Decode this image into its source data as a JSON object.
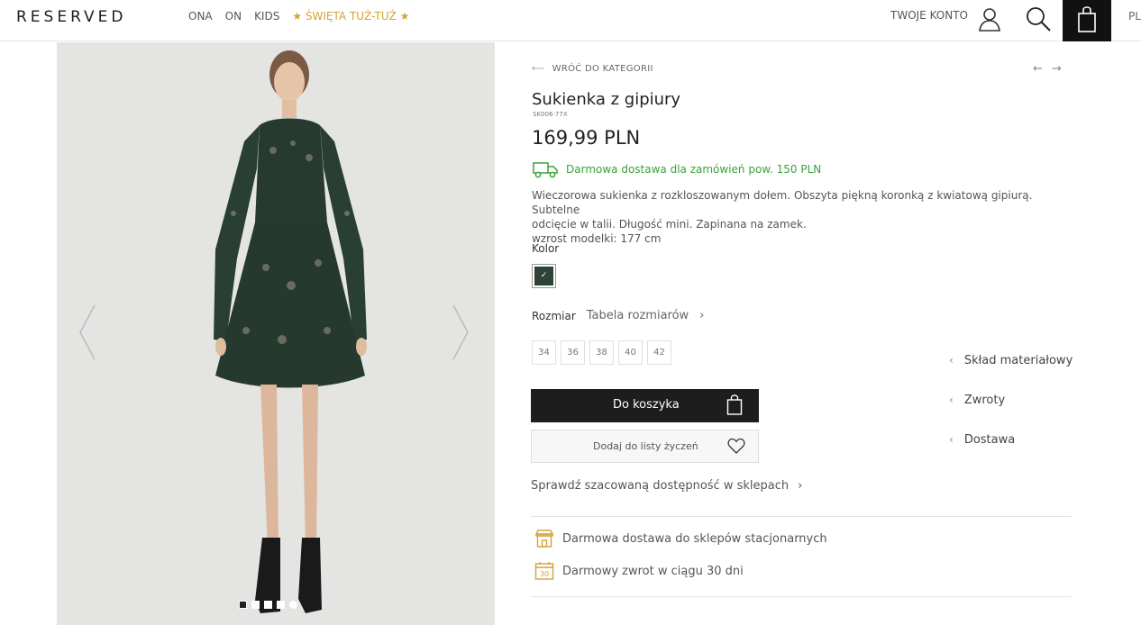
{
  "header": {
    "logo": "RESERVED",
    "nav": [
      {
        "label": "ONA"
      },
      {
        "label": "ON"
      },
      {
        "label": "KIDS"
      },
      {
        "label": "★ ŚWIĘTA TUŻ-TUŻ ★"
      }
    ],
    "account_label": "TWOJE KONTO",
    "language": "PL",
    "icons": [
      "user-icon",
      "search-icon",
      "shopping-bag-icon"
    ]
  },
  "gallery": {
    "image_alt": "green lace mini dress",
    "dots": 5,
    "active_dot": 0
  },
  "product": {
    "back_label": "WRÓĆ DO KATEGORII",
    "title": "Sukienka z gipiury",
    "sku": "SK006-77X",
    "price": "169,99 PLN",
    "delivery_note": "Darmowa dostawa dla zamówień pow. 150 PLN",
    "description_line1": "Wieczorowa sukienka z rozkloszowanym dołem. Obszyta piękną koronką z kwiatową gipiurą. Subtelne",
    "description_line2": "odcięcie w talii. Długość mini. Zapinana na zamek.",
    "description_line3": "wzrost modelki: 177 cm",
    "color_label": "Kolor",
    "color_swatch": "#2e4238",
    "size_label": "Rozmiar",
    "size_table_label": "Tabela rozmiarów",
    "sizes": [
      "34",
      "36",
      "38",
      "40",
      "42"
    ],
    "add_to_cart": "Do koszyka",
    "add_to_wishlist": "Dodaj do listy życzeń",
    "availability": "Sprawdź szacowaną dostępność w sklepach",
    "features": [
      {
        "label": "Darmowa dostawa do sklepów stacjonarnych",
        "icon": "store-icon"
      },
      {
        "label": "Darmowy zwrot w ciągu 30 dni",
        "icon": "calendar-30-icon"
      }
    ]
  },
  "side_links": [
    {
      "label": "Skład materiałowy"
    },
    {
      "label": "Zwroty"
    },
    {
      "label": "Dostawa"
    }
  ],
  "colors": {
    "promo": "#d4a23a",
    "delivery_green": "#3aa23a",
    "button_dark": "#1d1d1d"
  }
}
